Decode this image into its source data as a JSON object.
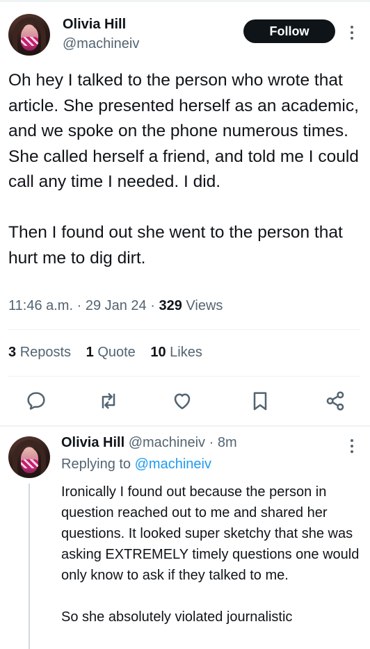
{
  "tweet": {
    "author_name": "Olivia Hill",
    "author_handle": "@machineiv",
    "follow_label": "Follow",
    "paragraphs": [
      "Oh hey I talked to the person who wrote that article. She presented herself as an academic, and we spoke on the phone numerous times. She called herself a friend, and told me I could call any time I needed. I did.",
      "Then I found out she went to the person that hurt me to dig dirt."
    ],
    "time": "11:46 a.m.",
    "date": "29 Jan 24",
    "views_count": "329",
    "views_label": "Views",
    "separator": "·"
  },
  "stats": {
    "reposts_count": "3",
    "reposts_label": "Reposts",
    "quotes_count": "1",
    "quotes_label": "Quote",
    "likes_count": "10",
    "likes_label": "Likes"
  },
  "actions": [
    "reply-icon",
    "repost-icon",
    "like-icon",
    "bookmark-icon",
    "share-icon"
  ],
  "reply": {
    "author_name": "Olivia Hill",
    "author_handle": "@machineiv",
    "time": "8m",
    "replying_prefix": "Replying to",
    "replying_handle": "@machineiv",
    "paragraphs": [
      "Ironically I found out because the person in question reached out to me and shared her questions. It looked super sketchy that she was asking EXTREMELY timely questions one would only know to ask if they talked to me.",
      "So she absolutely violated journalistic"
    ]
  },
  "colors": {
    "text": "#0f1419",
    "secondary": "#536471",
    "accent": "#1d9bf0",
    "divider": "#eff3f4"
  }
}
